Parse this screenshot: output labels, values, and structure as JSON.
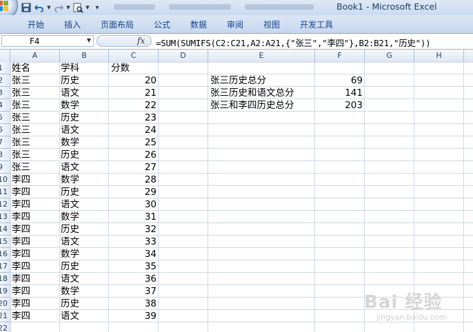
{
  "window": {
    "title": "Book1 - Microsoft Excel"
  },
  "ribbon": {
    "tabs": [
      "开始",
      "插入",
      "页面布局",
      "公式",
      "数据",
      "审阅",
      "视图",
      "开发工具"
    ]
  },
  "formula_bar": {
    "name_box": "F4",
    "fx": "fx",
    "formula": "=SUM(SUMIFS(C2:C21,A2:A21,{\"张三\",\"李四\"},B2:B21,\"历史\"))"
  },
  "sheet": {
    "columns": [
      "A",
      "B",
      "C",
      "D",
      "E",
      "F",
      "G",
      "H"
    ],
    "rows": [
      "1",
      "2",
      "3",
      "4",
      "5",
      "6",
      "7",
      "8",
      "9",
      "10",
      "11",
      "12",
      "13",
      "14",
      "15",
      "16",
      "17",
      "18",
      "19",
      "20",
      "21",
      "22"
    ],
    "header": {
      "name": "姓名",
      "subject": "学科",
      "score": "分数"
    },
    "data": [
      [
        "张三",
        "历史",
        "20"
      ],
      [
        "张三",
        "语文",
        "21"
      ],
      [
        "张三",
        "数学",
        "22"
      ],
      [
        "张三",
        "历史",
        "23"
      ],
      [
        "张三",
        "语文",
        "24"
      ],
      [
        "张三",
        "数学",
        "25"
      ],
      [
        "张三",
        "历史",
        "26"
      ],
      [
        "张三",
        "语文",
        "27"
      ],
      [
        "李四",
        "数学",
        "28"
      ],
      [
        "李四",
        "历史",
        "29"
      ],
      [
        "李四",
        "语文",
        "30"
      ],
      [
        "李四",
        "数学",
        "31"
      ],
      [
        "李四",
        "历史",
        "32"
      ],
      [
        "李四",
        "语文",
        "33"
      ],
      [
        "李四",
        "数学",
        "34"
      ],
      [
        "李四",
        "历史",
        "35"
      ],
      [
        "李四",
        "语文",
        "36"
      ],
      [
        "李四",
        "数学",
        "37"
      ],
      [
        "李四",
        "历史",
        "38"
      ],
      [
        "李四",
        "语文",
        "39"
      ]
    ],
    "summary": [
      {
        "label": "张三历史总分",
        "value": "69"
      },
      {
        "label": "张三历史和语文总分",
        "value": "141"
      },
      {
        "label": "张三和李四历史总分",
        "value": "203"
      }
    ]
  },
  "watermark": {
    "brand": "Bai 经验",
    "url": "jingyan.baidu.com"
  }
}
